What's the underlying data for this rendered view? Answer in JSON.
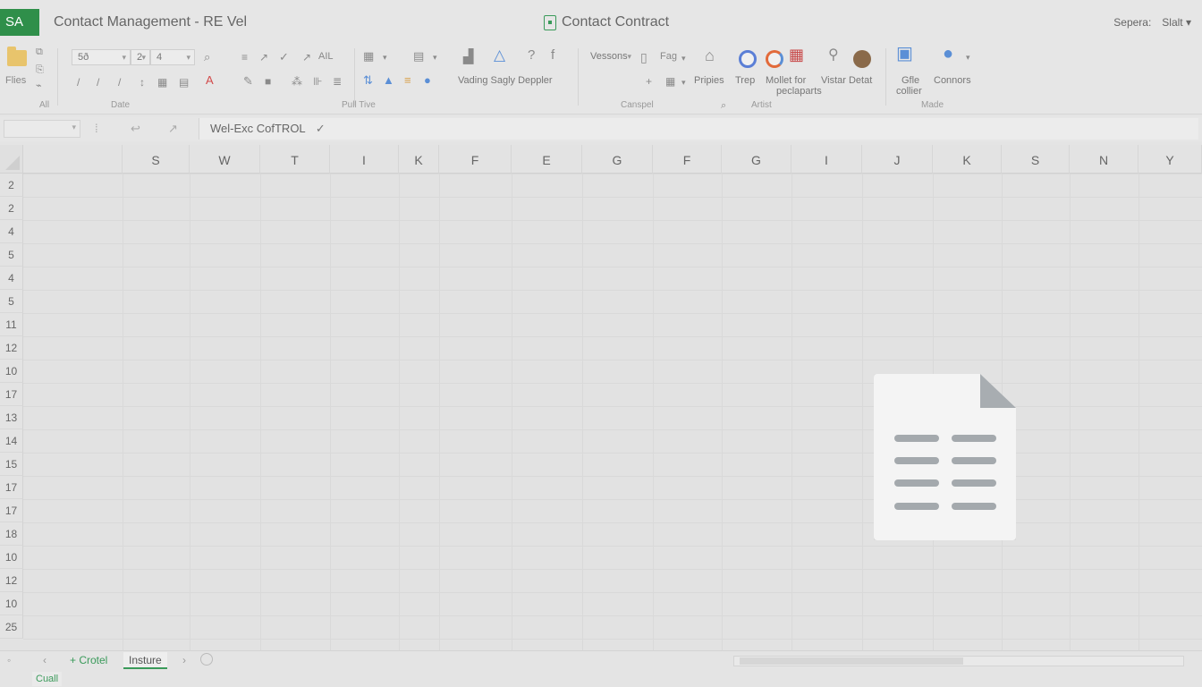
{
  "titlebar": {
    "app_badge": "SA",
    "doc_title": "Contact Management  -  RE  Vel",
    "center_title": "Contact Contract",
    "right_1": "Sepera:",
    "right_2": "Slalt ▾",
    "accent": "#2f8f4a"
  },
  "ribbon": {
    "files_label": "Flies",
    "font_box": "5ð",
    "size_box_1": "2",
    "size_box_2": "4",
    "number_format": "AIL",
    "group_all": "All",
    "group_date": "Date",
    "group_pull": "Pull Tive",
    "styles_label": "Vading Sagly Deppler",
    "versions_box": "Vessons",
    "find_label": "Fag",
    "properties_label": "Pripies",
    "trep_label": "Trep",
    "mollet_label_1": "Mollet for",
    "mollet_label_2": "peclaparts",
    "vistar_label": "Vistar Detat",
    "gfile_label_1": "Gfle",
    "gfile_label_2": "collier",
    "connors_label": "Connors",
    "group_carspel": "Canspel",
    "group_artist": "Artist",
    "group_made": "Made"
  },
  "formula_bar": {
    "value": "Wel-Exc CofTROL"
  },
  "grid": {
    "columns": [
      "S",
      "W",
      "T",
      "I",
      "K",
      "F",
      "E",
      "G",
      "F",
      "G",
      "I",
      "J",
      "K",
      "S",
      "N",
      "Y"
    ],
    "rows": [
      "2",
      "2",
      "4",
      "5",
      "4",
      "5",
      "11",
      "12",
      "10",
      "17",
      "13",
      "14",
      "15",
      "17",
      "17",
      "18",
      "10",
      "12",
      "10",
      "25"
    ]
  },
  "sheets": {
    "tab_1": "+ Crotel",
    "tab_2": "Insture"
  },
  "status": {
    "text": "Cuall"
  }
}
